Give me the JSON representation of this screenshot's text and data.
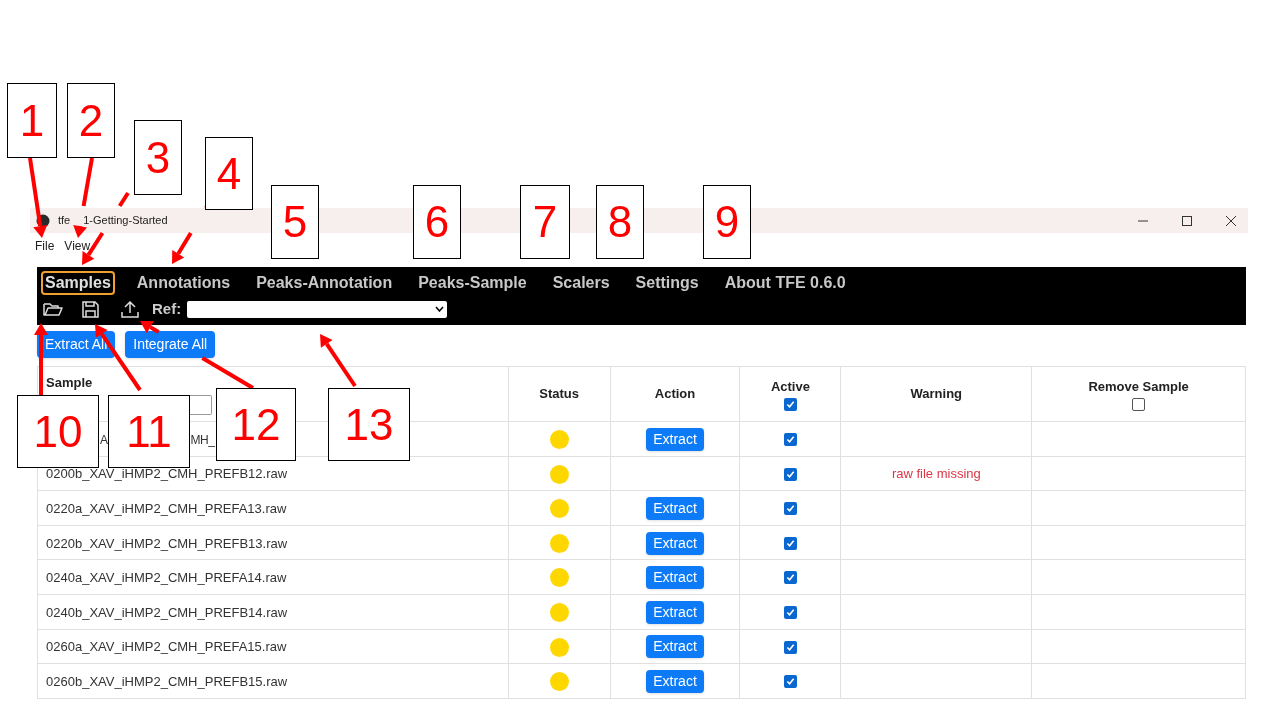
{
  "window": {
    "title_parts": [
      "tfe",
      "1-Getting-Started"
    ]
  },
  "menu": [
    "File",
    "View"
  ],
  "tabs": [
    {
      "label": "Samples",
      "selected": true
    },
    {
      "label": "Annotations",
      "selected": false
    },
    {
      "label": "Peaks-Annotation",
      "selected": false
    },
    {
      "label": "Peaks-Sample",
      "selected": false
    },
    {
      "label": "Scalers",
      "selected": false
    },
    {
      "label": "Settings",
      "selected": false
    },
    {
      "label": "About TFE 0.6.0",
      "selected": false
    }
  ],
  "toolbar": {
    "ref_label": "Ref:"
  },
  "buttons": [
    "Extract All",
    "Integrate All"
  ],
  "table": {
    "columns": [
      {
        "label": "Sample",
        "kind": "filter"
      },
      {
        "label": "Status",
        "kind": "plain"
      },
      {
        "label": "Action",
        "kind": "plain"
      },
      {
        "label": "Active",
        "kind": "checkbox",
        "checked": true
      },
      {
        "label": "Warning",
        "kind": "plain"
      },
      {
        "label": "Remove Sample",
        "kind": "checkbox",
        "checked": false
      }
    ],
    "rows": [
      {
        "sample_parts": [
          "A",
          "MH_"
        ],
        "color": "#ffd700",
        "action": "Extract",
        "active": true
      },
      {
        "sample": "0200b_XAV_iHMP2_CMH_PREFB12.raw",
        "color": "#ffd700",
        "active": true,
        "warning": "raw file missing"
      },
      {
        "sample": "0220a_XAV_iHMP2_CMH_PREFA13.raw",
        "color": "#ffd700",
        "action": "Extract",
        "active": true
      },
      {
        "sample": "0220b_XAV_iHMP2_CMH_PREFB13.raw",
        "color": "#ffd700",
        "action": "Extract",
        "active": true
      },
      {
        "sample": "0240a_XAV_iHMP2_CMH_PREFA14.raw",
        "color": "#ffd700",
        "action": "Extract",
        "active": true
      },
      {
        "sample": "0240b_XAV_iHMP2_CMH_PREFB14.raw",
        "color": "#ffd700",
        "action": "Extract",
        "active": true
      },
      {
        "sample": "0260a_XAV_iHMP2_CMH_PREFA15.raw",
        "color": "#ffd700",
        "action": "Extract",
        "active": true
      },
      {
        "sample": "0260b_XAV_iHMP2_CMH_PREFB15.raw",
        "color": "#ffd700",
        "action": "Extract",
        "active": true
      }
    ]
  },
  "callouts": [
    "1",
    "2",
    "3",
    "4",
    "5",
    "6",
    "7",
    "8",
    "9",
    "10",
    "11",
    "12",
    "13"
  ]
}
